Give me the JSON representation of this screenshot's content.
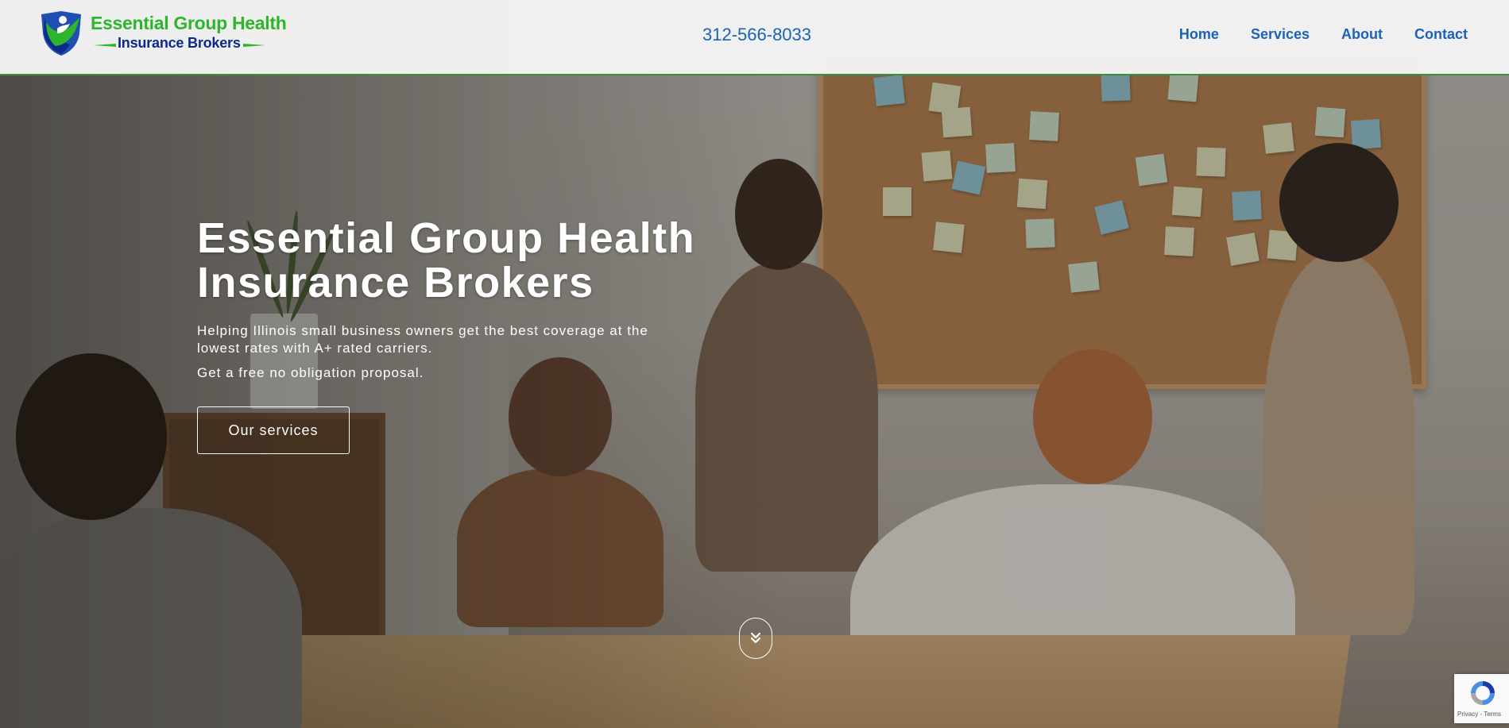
{
  "header": {
    "logo": {
      "line1": "Essential Group Health",
      "line2": "Insurance Brokers",
      "icon": "shield-person-icon"
    },
    "phone": "312-566-8033",
    "nav": [
      {
        "label": "Home"
      },
      {
        "label": "Services"
      },
      {
        "label": "About"
      },
      {
        "label": "Contact"
      }
    ]
  },
  "hero": {
    "title_line1": "Essential Group Health",
    "title_line2": "Insurance Brokers",
    "subtitle": "Helping Illinois small business owners get the best coverage at the lowest rates with A+ rated carriers.",
    "cta_text": "Get a free no obligation proposal.",
    "button_label": "Our services",
    "scroll_icon": "double-chevron-down-icon"
  },
  "recaptcha": {
    "links": "Privacy - Terms"
  },
  "colors": {
    "link_blue": "#1a63b8",
    "brand_green": "#2db52d",
    "brand_navy": "#0d2a8a",
    "header_border": "#3d8f3d"
  }
}
